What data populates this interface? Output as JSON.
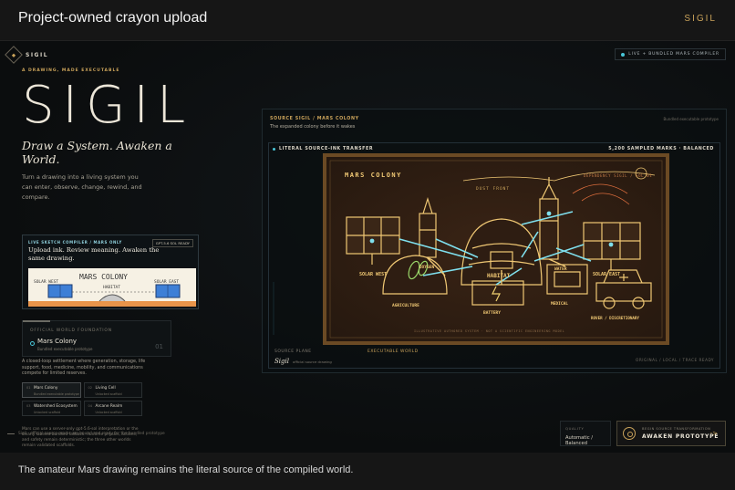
{
  "window": {
    "title": "Project-owned crayon upload",
    "brand": "SIGIL"
  },
  "header": {
    "logo": "SIGIL",
    "live_badge": "LIVE + BUNDLED MARS COMPILER"
  },
  "hero": {
    "eyebrow": "A DRAWING, MADE EXECUTABLE",
    "title": "SIGIL",
    "tagline": "Draw a System. Awaken a World.",
    "intro": "Turn a drawing into a living system you can enter, observe, change, rewind, and compare."
  },
  "compiler": {
    "header": "LIVE SKETCH COMPILER / MARS ONLY",
    "badge": "GPT-5.6 SOL READY",
    "message": "Upload ink. Review meaning. Awaken the same drawing.",
    "thumb_title": "MARS COLONY",
    "thumb_labels": [
      "SOLAR WEST",
      "HABITAT",
      "SOLAR EAST"
    ]
  },
  "foundation": {
    "header": "OFFICIAL WORLD FOUNDATION",
    "name": "Mars Colony",
    "sub": "Bundled executable prototype",
    "index": "01"
  },
  "description": "A closed-loop settlement where generation, storage, life support, food, medicine, mobility, and communications compete for limited reserves.",
  "worlds": [
    {
      "num": "01",
      "title": "Mars Colony",
      "sub": "Bundled executable prototype"
    },
    {
      "num": "02",
      "title": "Living Cell",
      "sub": "Unlocked scaffold"
    },
    {
      "num": "03",
      "title": "Watershed Ecosystem",
      "sub": "Unlocked scaffold"
    },
    {
      "num": "04",
      "title": "Arcane Realm",
      "sub": "Unlocked scaffold"
    }
  ],
  "note": "Mars can use a server-only gpt-5.6-sol interpretation or the clearly labeled bundled fallback. Runtime physics, actions, and safety remain deterministic; the three other worlds remain validated scaffolds.",
  "footer_note": "Sigil · official source marks are bound and ready for the bundled prototype",
  "stage": {
    "title": "SOURCE SIGIL / MARS COLONY",
    "subtitle": "The expanded colony before it wakes",
    "right": "Bundled executable prototype",
    "inner_left": "LITERAL SOURCE-INK TRANSFER",
    "inner_right": "5,200 SAMPLED MARKS · BALANCED",
    "source_plane": "SOURCE PLANE",
    "executable_world": "EXECUTABLE WORLD",
    "sigil_mark": "Sigil",
    "sigil_sub": "official source drawing",
    "original": "ORIGINAL / LOCAL / TRACE READY"
  },
  "drawing": {
    "title": "MARS COLONY",
    "dependency": "DEPENDENCY SIGIL / SOL 01",
    "dust": "DUST FRONT",
    "labels": {
      "solar_west": "SOLAR WEST",
      "oxygen": "OXYGEN",
      "water": "WATER",
      "solar_east": "SOLAR EAST",
      "habitat": "HABITAT",
      "agriculture": "AGRICULTURE",
      "battery": "BATTERY",
      "medical": "MEDICAL",
      "rover": "ROVER / DISCRETIONARY"
    },
    "footer": "ILLUSTRATIVE AUTHORED SYSTEM · NOT A SCIENTIFIC ENGINEERING MODEL"
  },
  "controls": {
    "quality_label": "QUALITY",
    "quality_value": "Automatic / Balanced",
    "awaken_label": "BEGIN SOURCE TRANSFORMATION",
    "awaken_value": "AWAKEN PROTOTYPE",
    "awaken_arrow": "->"
  },
  "caption": "The amateur Mars drawing remains the literal source of the compiled world.",
  "colors": {
    "accent_gold": "#c9a25a",
    "accent_cyan": "#49c6d8",
    "ink": "#f0c874"
  }
}
